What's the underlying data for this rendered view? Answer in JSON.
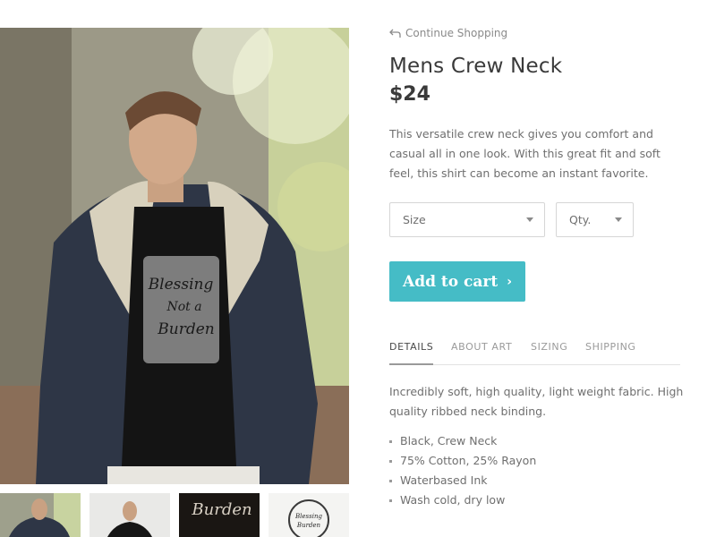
{
  "nav": {
    "continue_label": "Continue Shopping",
    "continue_icon": "return-arrow-icon"
  },
  "product": {
    "title": "Mens Crew Neck",
    "price": "$24",
    "description": "This versatile crew neck gives you comfort and casual all in one look. With this great fit and soft feel, this shirt can become an instant favorite.",
    "shirt_print": {
      "line1": "Blessing",
      "line2": "Not a",
      "line3": "Burden"
    }
  },
  "options": {
    "size_placeholder": "Size",
    "qty_placeholder": "Qty."
  },
  "cart": {
    "add_label": "Add to cart",
    "add_icon": "chevron-right-icon",
    "button_color": "#45bcc6"
  },
  "tabs": [
    {
      "label": "DETAILS",
      "active": true
    },
    {
      "label": "ABOUT ART",
      "active": false
    },
    {
      "label": "SIZING",
      "active": false
    },
    {
      "label": "SHIPPING",
      "active": false
    }
  ],
  "details": {
    "text": "Incredibly soft, high quality, light weight fabric. High quality ribbed neck binding.",
    "features": [
      "Black, Crew Neck",
      "75% Cotton, 25% Rayon",
      "Waterbased Ink",
      "Wash cold, dry low"
    ]
  },
  "thumbnails": [
    {
      "name": "model-jacket-thumbnail",
      "selected": true
    },
    {
      "name": "model-front-thumbnail",
      "selected": false
    },
    {
      "name": "print-closeup-thumbnail",
      "selected": false
    },
    {
      "name": "print-art-thumbnail",
      "selected": false
    }
  ]
}
